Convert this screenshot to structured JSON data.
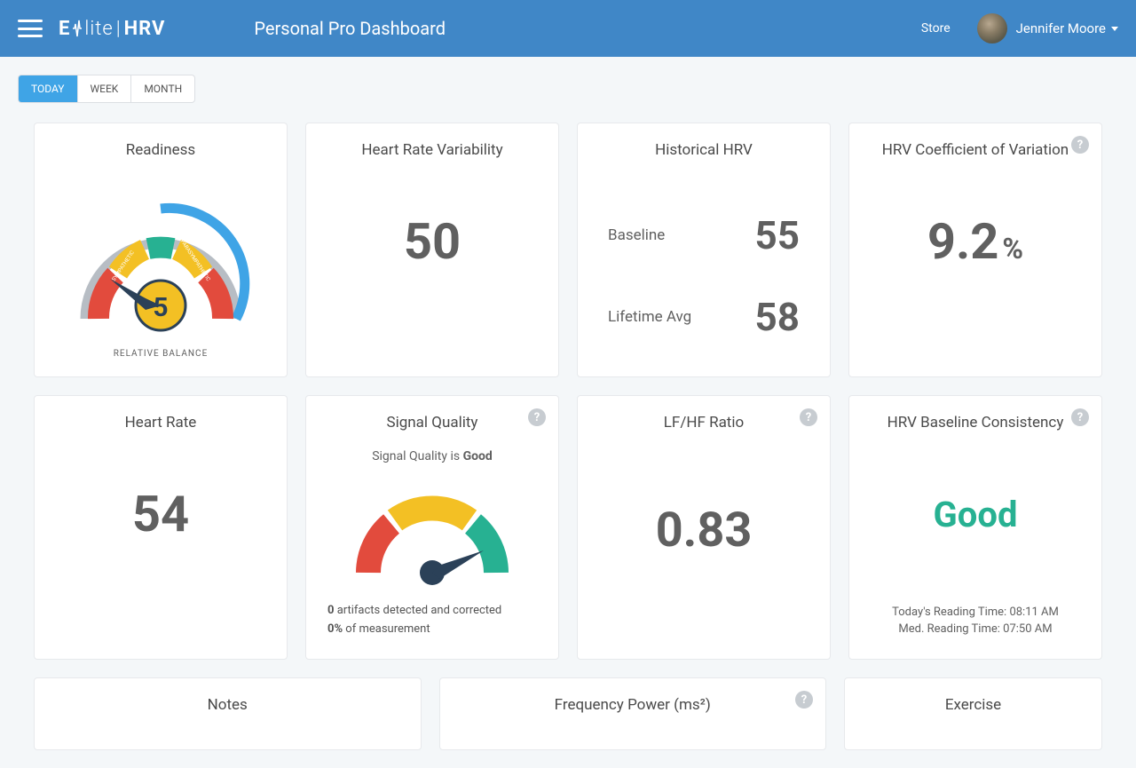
{
  "header": {
    "page_title": "Personal Pro Dashboard",
    "store_label": "Store",
    "username": "Jennifer Moore",
    "logo_prefix": "E",
    "logo_mid": "lite",
    "logo_suffix": "HRV"
  },
  "tabs": [
    {
      "label": "TODAY",
      "active": true
    },
    {
      "label": "WEEK",
      "active": false
    },
    {
      "label": "MONTH",
      "active": false
    }
  ],
  "cards": {
    "readiness": {
      "title": "Readiness",
      "score": "5",
      "caption": "RELATIVE BALANCE",
      "left_arc_label": "SYMPATHETIC",
      "right_arc_label": "PARASYMPATHETIC"
    },
    "hrv": {
      "title": "Heart Rate Variability",
      "value": "50"
    },
    "historical": {
      "title": "Historical HRV",
      "rows": [
        {
          "label": "Baseline",
          "value": "55"
        },
        {
          "label": "Lifetime Avg",
          "value": "58"
        }
      ]
    },
    "cov": {
      "title": "HRV Coefficient of Variation",
      "value": "9.2",
      "unit": "%"
    },
    "hr": {
      "title": "Heart Rate",
      "value": "54"
    },
    "signal": {
      "title": "Signal Quality",
      "text_prefix": "Signal Quality is ",
      "text_value": "Good",
      "artifacts_count": "0",
      "artifacts_suffix": " artifacts detected and corrected",
      "pct_value": "0%",
      "pct_suffix": " of measurement"
    },
    "lfhf": {
      "title": "LF/HF Ratio",
      "value": "0.83"
    },
    "baseline": {
      "title": "HRV Baseline Consistency",
      "status": "Good",
      "today_label": "Today's Reading Time: ",
      "today_val": "08:11 AM",
      "med_label": "Med. Reading Time: ",
      "med_val": "07:50 AM"
    },
    "notes": {
      "title": "Notes"
    },
    "freq": {
      "title": "Frequency Power (ms²)"
    },
    "exercise": {
      "title": "Exercise"
    }
  }
}
